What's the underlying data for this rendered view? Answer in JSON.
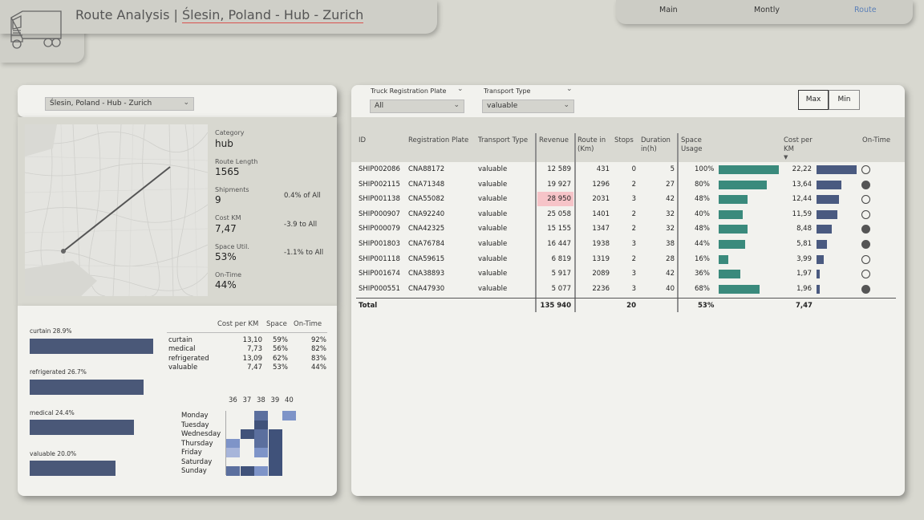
{
  "header": {
    "title_prefix": "Route Analysis | ",
    "route_name": "Ślesin, Poland - Hub - Zurich"
  },
  "nav": {
    "items": [
      "Main",
      "Montly",
      "Route"
    ],
    "active": "Route"
  },
  "left": {
    "route_select": "Ślesin, Poland - Hub - Zurich",
    "kpis": {
      "category_label": "Category",
      "category_value": "hub",
      "length_label": "Route Length",
      "length_value": "1565",
      "shipments_label": "Shipments",
      "shipments_value": "9",
      "shipments_delta": "0.4% of All",
      "cost_label": "Cost KM",
      "cost_value": "7,47",
      "cost_delta": "-3.9 to All",
      "space_label": "Space Util.",
      "space_value": "53%",
      "space_delta": "-1.1% to All",
      "ontime_label": "On-Time",
      "ontime_value": "44%"
    },
    "categories": [
      {
        "label": "curtain 28.9%",
        "share": 28.9
      },
      {
        "label": "refrigerated 26.7%",
        "share": 26.7
      },
      {
        "label": "medical 24.4%",
        "share": 24.4
      },
      {
        "label": "valuable 20.0%",
        "share": 20.0
      }
    ],
    "small_table": {
      "headers": [
        "Cost per KM",
        "Space",
        "On-Time"
      ],
      "rows": [
        {
          "name": "curtain",
          "cost": "13,10",
          "space": "59%",
          "ontime": "92%"
        },
        {
          "name": "medical",
          "cost": "7,73",
          "space": "56%",
          "ontime": "82%"
        },
        {
          "name": "refrigerated",
          "cost": "13,09",
          "space": "62%",
          "ontime": "83%"
        },
        {
          "name": "valuable",
          "cost": "7,47",
          "space": "53%",
          "ontime": "44%"
        }
      ]
    },
    "heatmap": {
      "weeks": [
        "36",
        "37",
        "38",
        "39",
        "40"
      ],
      "days": [
        "Monday",
        "Tuesday",
        "Wednesday",
        "Thursday",
        "Friday",
        "Saturday",
        "Sunday"
      ],
      "colors": {
        "c1": "#7e94c8",
        "c2": "#5b6f9e",
        "c3": "#40527a",
        "c4": "#a7b5da"
      },
      "cells": [
        [
          null,
          null,
          "c2",
          null,
          "c1"
        ],
        [
          null,
          null,
          "c3",
          null,
          null
        ],
        [
          null,
          "c3",
          "c2",
          "c3",
          null
        ],
        [
          "c1",
          null,
          "c2",
          "c3",
          null
        ],
        [
          "c4",
          null,
          "c1",
          "c3",
          null
        ],
        [
          null,
          null,
          null,
          "c3",
          null
        ],
        [
          "c2",
          "c3",
          "c1",
          "c3",
          null
        ]
      ]
    }
  },
  "filters": {
    "plate_label": "Truck Registration Plate",
    "plate_value": "All",
    "type_label": "Transport Type",
    "type_value": "valuable",
    "max_label": "Max",
    "min_label": "Min"
  },
  "table": {
    "headers": {
      "id": "ID",
      "plate": "Registration Plate",
      "type": "Transport Type",
      "revenue": "Revenue",
      "route": "Route in (Km)",
      "stops": "Stops",
      "duration": "Duration in(h)",
      "space": "Space Usage",
      "cost": "Cost per KM",
      "ontime": "On-Time"
    },
    "rows": [
      {
        "id": "SHIP002086",
        "plate": "CNA88172",
        "type": "valuable",
        "revenue": "12 589",
        "route": "431",
        "stops": "0",
        "duration": "5",
        "space": "100%",
        "space_v": 100,
        "cost": "22,22",
        "cost_v": 22.22,
        "ontime": false,
        "highlight": false
      },
      {
        "id": "SHIP002115",
        "plate": "CNA71348",
        "type": "valuable",
        "revenue": "19 927",
        "route": "1296",
        "stops": "2",
        "duration": "27",
        "space": "80%",
        "space_v": 80,
        "cost": "13,64",
        "cost_v": 13.64,
        "ontime": true,
        "highlight": false
      },
      {
        "id": "SHIP001138",
        "plate": "CNA55082",
        "type": "valuable",
        "revenue": "28 950",
        "route": "2031",
        "stops": "3",
        "duration": "42",
        "space": "48%",
        "space_v": 48,
        "cost": "12,44",
        "cost_v": 12.44,
        "ontime": false,
        "highlight": true
      },
      {
        "id": "SHIP000907",
        "plate": "CNA92240",
        "type": "valuable",
        "revenue": "25 058",
        "route": "1401",
        "stops": "2",
        "duration": "32",
        "space": "40%",
        "space_v": 40,
        "cost": "11,59",
        "cost_v": 11.59,
        "ontime": false,
        "highlight": false
      },
      {
        "id": "SHIP000079",
        "plate": "CNA42325",
        "type": "valuable",
        "revenue": "15 155",
        "route": "1347",
        "stops": "2",
        "duration": "32",
        "space": "48%",
        "space_v": 48,
        "cost": "8,48",
        "cost_v": 8.48,
        "ontime": true,
        "highlight": false
      },
      {
        "id": "SHIP001803",
        "plate": "CNA76784",
        "type": "valuable",
        "revenue": "16 447",
        "route": "1938",
        "stops": "3",
        "duration": "38",
        "space": "44%",
        "space_v": 44,
        "cost": "5,81",
        "cost_v": 5.81,
        "ontime": true,
        "highlight": false
      },
      {
        "id": "SHIP001118",
        "plate": "CNA59615",
        "type": "valuable",
        "revenue": "6 819",
        "route": "1319",
        "stops": "2",
        "duration": "28",
        "space": "16%",
        "space_v": 16,
        "cost": "3,99",
        "cost_v": 3.99,
        "ontime": false,
        "highlight": false
      },
      {
        "id": "SHIP001674",
        "plate": "CNA38893",
        "type": "valuable",
        "revenue": "5 917",
        "route": "2089",
        "stops": "3",
        "duration": "42",
        "space": "36%",
        "space_v": 36,
        "cost": "1,97",
        "cost_v": 1.97,
        "ontime": false,
        "highlight": false
      },
      {
        "id": "SHIP000551",
        "plate": "CNA47930",
        "type": "valuable",
        "revenue": "5 077",
        "route": "2236",
        "stops": "3",
        "duration": "40",
        "space": "68%",
        "space_v": 68,
        "cost": "1,96",
        "cost_v": 1.96,
        "ontime": true,
        "highlight": false
      }
    ],
    "total": {
      "label": "Total",
      "revenue": "135 940",
      "stops": "20",
      "space": "53%",
      "cost": "7,47"
    }
  },
  "colors": {
    "space_bar": "#3a8a7c",
    "cost_bar": "#4a5a80",
    "highlight": "#f6c4c8",
    "category_bar": "#4a5878"
  }
}
